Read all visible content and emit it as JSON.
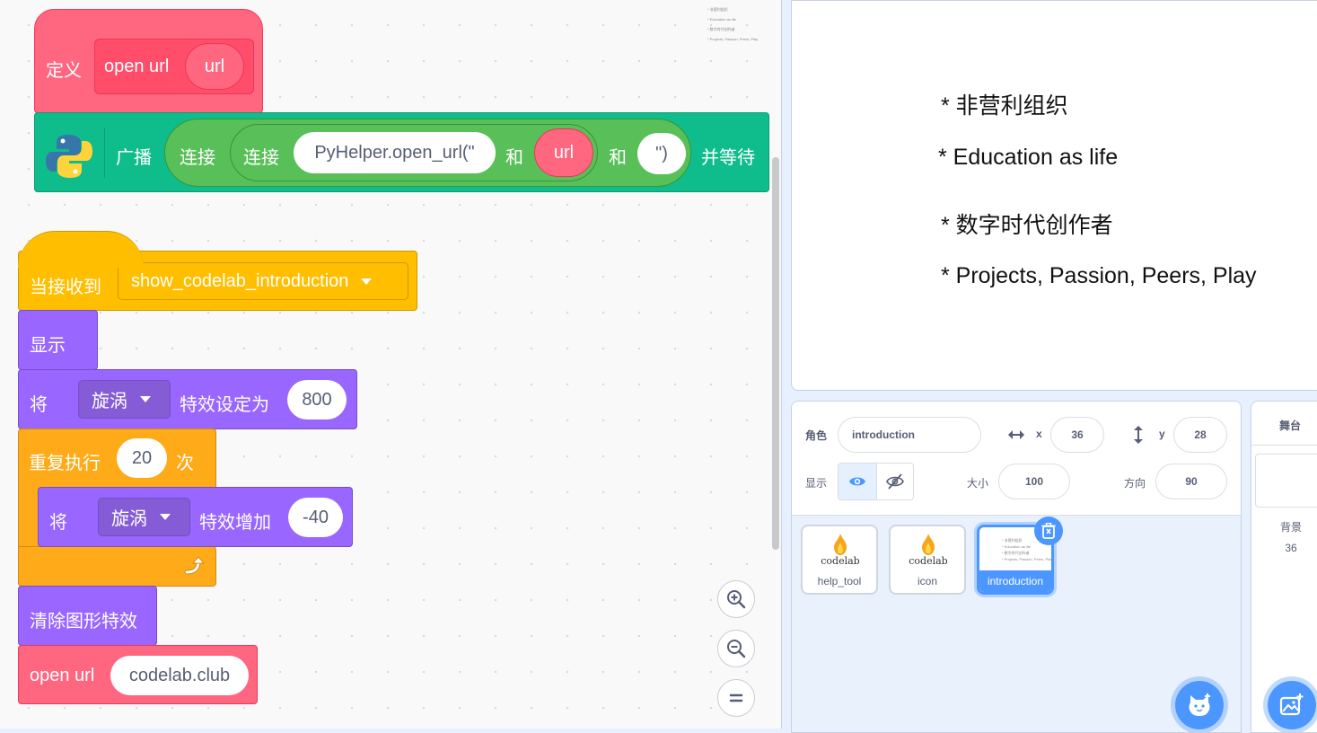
{
  "script1": {
    "define_label": "定义",
    "proc_name": "open url",
    "proc_arg": "url",
    "broadcast_label": "广播",
    "join_label": "连接",
    "join_label_2": "连接",
    "str_open": "PyHelper.open_url(\"",
    "and_1": "和",
    "url_arg": "url",
    "and_2": "和",
    "str_close": "\")",
    "wait_label": "并等待"
  },
  "script2": {
    "hat_label": "当接收到",
    "message": "show_codelab_introduction",
    "show": "显示",
    "set_label": "将",
    "effect": "旋涡",
    "set_to_label": "特效设定为",
    "set_value": "800",
    "repeat_label": "重复执行",
    "repeat_count": "20",
    "times_label": "次",
    "change_label": "将",
    "effect_2": "旋涡",
    "change_by_label": "特效增加",
    "change_value": "-40",
    "clear_effects": "清除图形特效",
    "open_url_label": "open url",
    "open_url_value": "codelab.club"
  },
  "stage": {
    "lines": [
      "*  非营利组织",
      "*  Education as life",
      "*  数字时代创作者",
      "*  Projects, Passion, Peers, Play"
    ],
    "mini_lines": [
      "* 非营利组织",
      "* Education as life",
      "* 数字时代创作者",
      "* Projects, Passion, Peers, Play"
    ]
  },
  "sprite_info": {
    "sprite_label": "角色",
    "sprite_name": "introduction",
    "x_label": "x",
    "x_value": "36",
    "y_label": "y",
    "y_value": "28",
    "show_label": "显示",
    "size_label": "大小",
    "size_value": "100",
    "direction_label": "方向",
    "direction_value": "90"
  },
  "sprites": [
    {
      "name": "help_tool",
      "logo_text": "codelab"
    },
    {
      "name": "icon",
      "logo_text": "codelab"
    },
    {
      "name": "introduction"
    }
  ],
  "stage_pane": {
    "title": "舞台",
    "backdrop_label": "背景",
    "backdrop_count": "36"
  },
  "colors": {
    "events": "#ffbf00",
    "looks": "#9966ff",
    "control": "#ffab19",
    "custom": "#ff6680",
    "extension": "#0fbd8c",
    "operators": "#59c059",
    "accent": "#4c97ff"
  }
}
